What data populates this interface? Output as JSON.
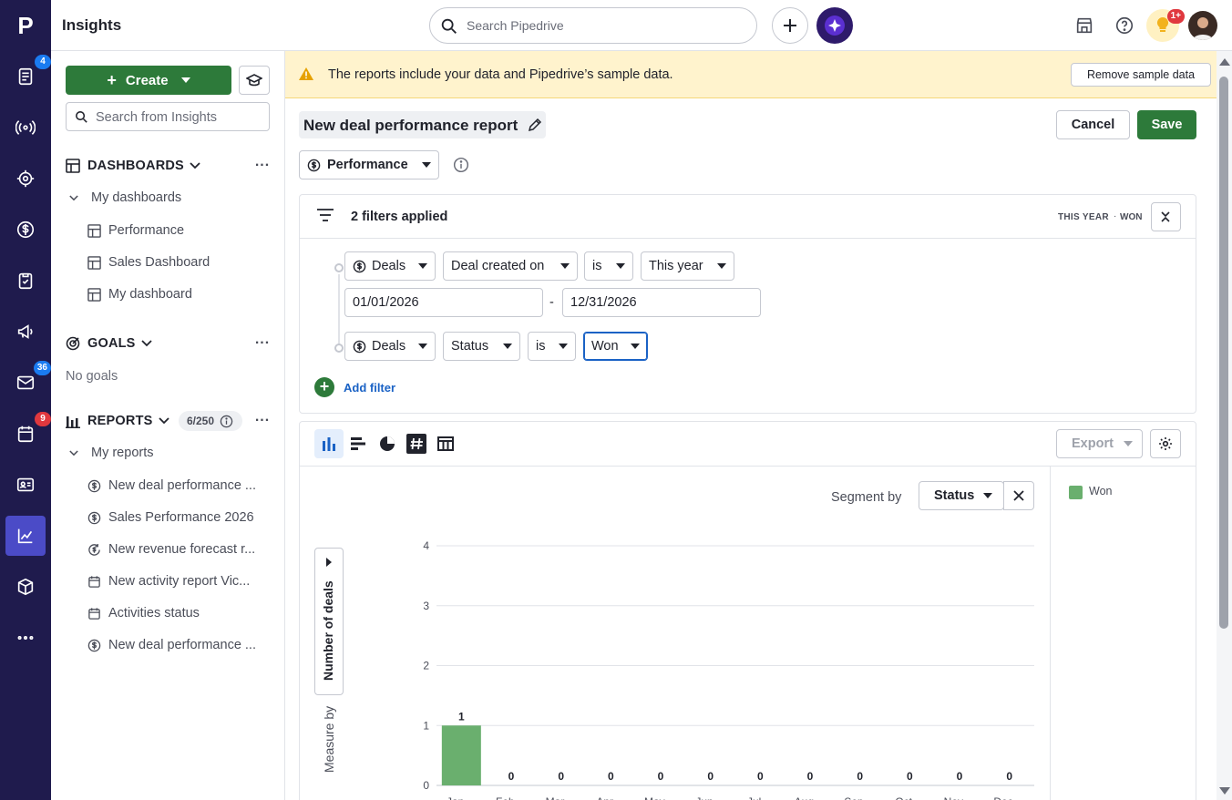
{
  "app": {
    "logo": "P",
    "title": "Insights"
  },
  "top": {
    "search_placeholder": "Search Pipedrive",
    "notif_badge": "1+"
  },
  "rail": {
    "badges": {
      "leads": "4",
      "mail": "36",
      "activities": "9"
    }
  },
  "sidebar": {
    "create_label": "Create",
    "search_placeholder": "Search from Insights",
    "dashboards": {
      "title": "DASHBOARDS",
      "group": "My dashboards",
      "items": [
        "Performance",
        "Sales Dashboard",
        "My dashboard"
      ]
    },
    "goals": {
      "title": "GOALS",
      "empty": "No goals"
    },
    "reports": {
      "title": "REPORTS",
      "count": "6/250",
      "group": "My reports",
      "items": [
        "New deal performance ...",
        "Sales Performance 2026",
        "New revenue forecast r...",
        "New activity report Vic...",
        "Activities status",
        "New deal performance ..."
      ]
    }
  },
  "banner": {
    "text": "The reports include your data and Pipedrive’s sample data.",
    "button": "Remove sample data"
  },
  "report": {
    "title": "New deal performance report",
    "cancel": "Cancel",
    "save": "Save",
    "type": "Performance"
  },
  "filters": {
    "summary": "2 filters applied",
    "tags": "THIS YEAR",
    "tag2": "WON",
    "row1": {
      "entity": "Deals",
      "field": "Deal created on",
      "op": "is",
      "value": "This year",
      "from": "01/01/2026",
      "sep": "-",
      "to": "12/31/2026"
    },
    "row2": {
      "entity": "Deals",
      "field": "Status",
      "op": "is",
      "value": "Won"
    },
    "add": "Add filter"
  },
  "chart_toolbar": {
    "export": "Export",
    "segment_label": "Segment by",
    "segment_value": "Status",
    "measure_label": "Measure by",
    "measure_value": "Number of deals"
  },
  "colors": {
    "won": "#6aaf6e",
    "accent": "#2d7a3a",
    "rail": "#1f1b4d"
  },
  "chart_data": {
    "type": "bar",
    "categories": [
      "Jan ...",
      "Feb ...",
      "Mar ...",
      "Apr ...",
      "May ...",
      "Jun ...",
      "Jul ...",
      "Aug ...",
      "Sep ...",
      "Oct ...",
      "Nov ...",
      "Dec ..."
    ],
    "series": [
      {
        "name": "Won",
        "values": [
          1,
          0,
          0,
          0,
          0,
          0,
          0,
          0,
          0,
          0,
          0,
          0
        ]
      }
    ],
    "data_labels": [
      "1",
      "0",
      "0",
      "0",
      "0",
      "0",
      "0",
      "0",
      "0",
      "0",
      "0",
      "0"
    ],
    "yticks": [
      "0",
      "1",
      "2",
      "3",
      "4"
    ],
    "ylim": [
      0,
      4
    ],
    "ylabel": "Number of deals",
    "grid": true,
    "legend": "right"
  }
}
